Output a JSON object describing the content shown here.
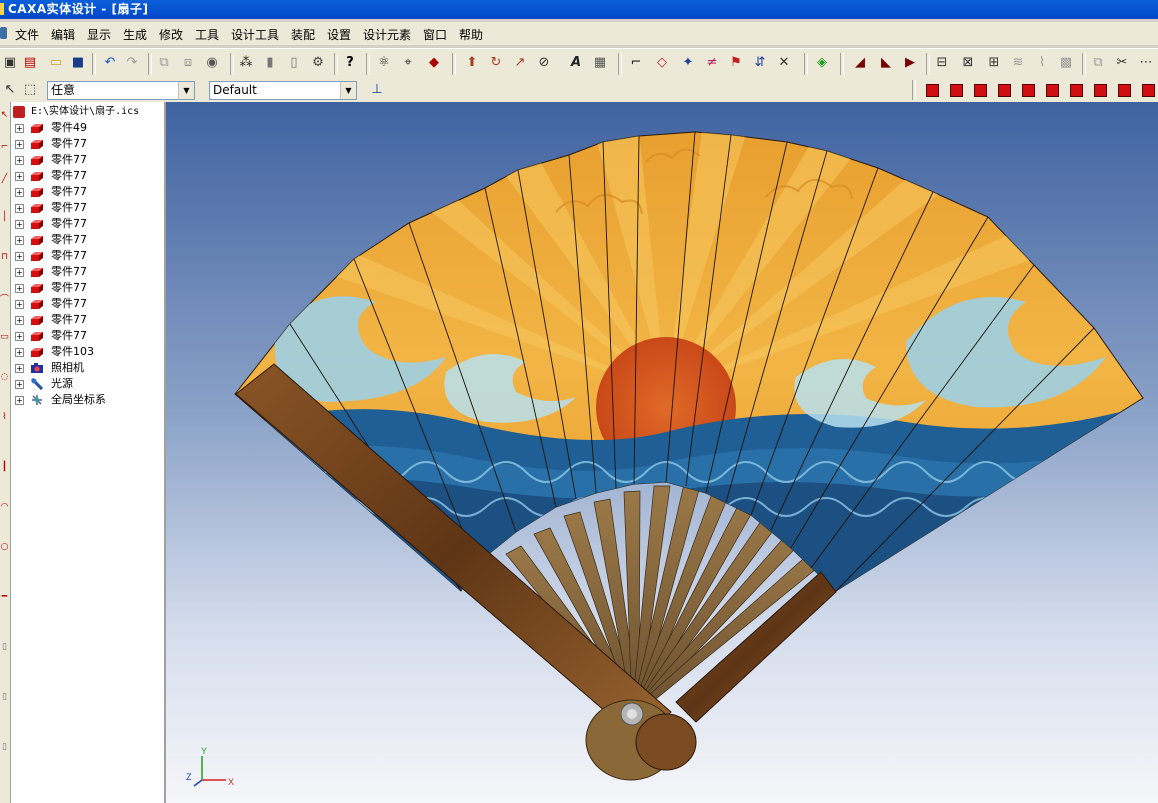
{
  "window": {
    "title": "CAXA实体设计 - [扇子]"
  },
  "menu": [
    "文件",
    "编辑",
    "显示",
    "生成",
    "修改",
    "工具",
    "设计工具",
    "装配",
    "设置",
    "设计元素",
    "窗口",
    "帮助"
  ],
  "selection": {
    "filter_value": "任意",
    "style_value": "Default"
  },
  "tree": {
    "root": "E:\\实体设计\\扇子.ics",
    "items": [
      {
        "label": "零件49",
        "icon": "part-icon"
      },
      {
        "label": "零件77",
        "icon": "part-icon"
      },
      {
        "label": "零件77",
        "icon": "part-icon"
      },
      {
        "label": "零件77",
        "icon": "part-icon"
      },
      {
        "label": "零件77",
        "icon": "part-icon"
      },
      {
        "label": "零件77",
        "icon": "part-icon"
      },
      {
        "label": "零件77",
        "icon": "part-icon"
      },
      {
        "label": "零件77",
        "icon": "part-icon"
      },
      {
        "label": "零件77",
        "icon": "part-icon"
      },
      {
        "label": "零件77",
        "icon": "part-icon"
      },
      {
        "label": "零件77",
        "icon": "part-icon"
      },
      {
        "label": "零件77",
        "icon": "part-icon"
      },
      {
        "label": "零件77",
        "icon": "part-icon"
      },
      {
        "label": "零件77",
        "icon": "part-icon"
      },
      {
        "label": "零件103",
        "icon": "part-icon"
      },
      {
        "label": "照相机",
        "icon": "camera-icon"
      },
      {
        "label": "光源",
        "icon": "light-icon"
      },
      {
        "label": "全局坐标系",
        "icon": "coordinate-system-icon"
      }
    ]
  },
  "axes": {
    "x": "X",
    "y": "Y",
    "z": "Z"
  },
  "colors": {
    "fan_rib": "#8a6838",
    "fan_paper": "#f0a830",
    "sun": "#d85a20",
    "wave": "#1f5f95",
    "guard": "#7a4a22"
  }
}
